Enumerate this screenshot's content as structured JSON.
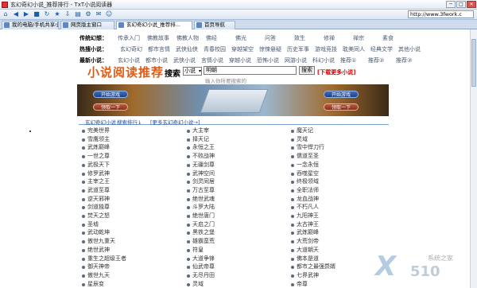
{
  "window": {
    "title": "玄幻奇幻小说_推荐排行 - TxT小说阅读器",
    "minimize": "─",
    "maximize": "□",
    "close": "✕"
  },
  "toolbar": {
    "icons": [
      "home-icon",
      "back-icon",
      "forward-icon",
      "stop-icon",
      "refresh-icon",
      "star-icon",
      "download-icon",
      "book-icon",
      "settings-icon",
      "mail-icon",
      "smile-icon"
    ],
    "icon_glyphs": [
      "⌂",
      "◀",
      "▶",
      "■",
      "↻",
      "★",
      "⇩",
      "▤",
      "⚙",
      "✉",
      "☺"
    ],
    "url": "http://www.3fwork.c"
  },
  "tabs": [
    "我的电脑/手机共享小说",
    "网页版主窗口",
    "玄幻奇幻小说_推荐排...",
    "首页导航"
  ],
  "nav": {
    "row1": {
      "label": "传统幻想：",
      "items": [
        "传承入门",
        "佛教故事",
        "佛教人物",
        "佛经",
        "佛光",
        "问答",
        "致生",
        "修禅",
        "禅宗",
        "素食"
      ]
    },
    "row2": {
      "label": "热搜小说：",
      "items": [
        "玄幻奇幻",
        "都市言情",
        "武侠仙侠",
        "青春校园",
        "穿越架空",
        "惊悚悬疑",
        "历史军事",
        "游戏竞技",
        "耽美同人",
        "经典文学",
        "其他小说"
      ]
    },
    "row3": {
      "label": "最新小说：",
      "items": [
        "玄幻小说",
        "都市小说",
        "武侠小说",
        "言情小说",
        "穿越小说",
        "恐怖小说",
        "网游小说",
        "科幻小说",
        "推荐①",
        "推荐②",
        "推荐③"
      ]
    }
  },
  "logo": "小说阅读推荐",
  "search": {
    "label": "搜索",
    "select_value": "小说",
    "input_value": "明朝",
    "button": "搜索",
    "more": "[下载更多小说]",
    "hint": "输入你所要搜索的"
  },
  "banner": {
    "btn_start": "开始游戏",
    "btn_upgrade": "领取一下"
  },
  "section": {
    "link1": "玄幻奇幻小说",
    "link2": "搜索排行↓",
    "link3": "[更多玄幻奇幻小说→]"
  },
  "novels": {
    "col1": [
      "完美世界",
      "雪鹰领主",
      "武炼巅峰",
      "一世之尊",
      "武极天下",
      "修罗武神",
      "主宰之王",
      "武道至尊",
      "逆天邪神",
      "剑道独尊",
      "焚天之怒",
      "圣墟",
      "武动乾坤",
      "傲世九重天",
      "绝世武神",
      "重生之超级王者",
      "御天神帝",
      "傲世九天",
      "星辰变"
    ],
    "col2": [
      "大主宰",
      "择天记",
      "永恒之王",
      "不败战神",
      "无疆剑尊",
      "武神空间",
      "剑灵同居",
      "万古至尊",
      "绝世武魂",
      "斗罗大陆",
      "绝世唐门",
      "天启之门",
      "黑铁之堡",
      "雄霸蛮荒",
      "符皇",
      "大道争锋",
      "仙武帝尊",
      "无尽丹田",
      "灵域"
    ],
    "col3": [
      "魔天记",
      "灵域",
      "雪中悍刀行",
      "儒道至圣",
      "一念永恒",
      "吞噬星空",
      "终极领域",
      "全职法师",
      "龙血战神",
      "不朽凡人",
      "九阳神王",
      "太古神王",
      "武炼巅峰",
      "大荒剑帝",
      "大道朝天",
      "佛本是道",
      "都市之最强赘婿",
      "七界武神",
      "帝尊"
    ]
  }
}
